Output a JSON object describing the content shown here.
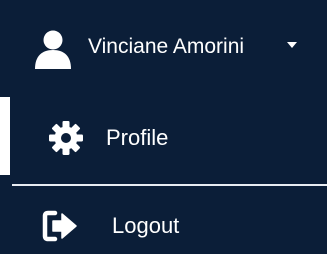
{
  "user_menu": {
    "user_name": "Vinciane Amorini",
    "user_icon": "user-icon",
    "caret_icon": "caret-down-icon"
  },
  "menu_items": [
    {
      "label": "Profile",
      "icon": "gear-icon",
      "active": true
    },
    {
      "label": "Logout",
      "icon": "sign-out-icon",
      "active": false
    }
  ],
  "colors": {
    "background": "#0b1e38",
    "text": "#ffffff",
    "divider": "#e8ecf2"
  }
}
